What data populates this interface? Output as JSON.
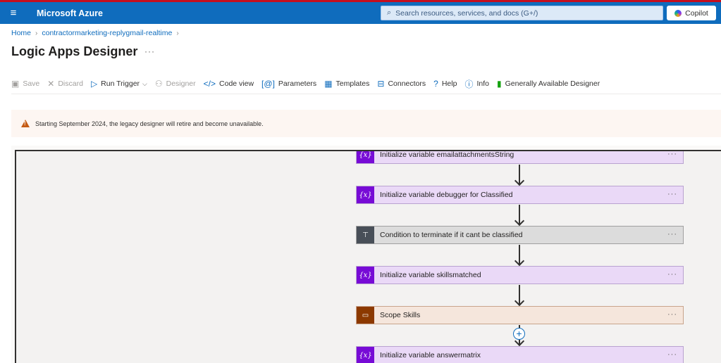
{
  "header": {
    "menu_icon": "hamburger-icon",
    "brand": "Microsoft Azure",
    "search_placeholder": "Search resources, services, and docs (G+/)",
    "copilot_label": "Copilot"
  },
  "breadcrumb": {
    "home": "Home",
    "resource": "contractormarketing-replygmail-realtime"
  },
  "page": {
    "title": "Logic Apps Designer",
    "more": "···"
  },
  "toolbar": {
    "save": "Save",
    "discard": "Discard",
    "run_trigger": "Run Trigger",
    "designer": "Designer",
    "code_view": "Code view",
    "parameters": "Parameters",
    "templates": "Templates",
    "connectors": "Connectors",
    "help": "Help",
    "info": "Info",
    "ga_designer": "Generally Available Designer"
  },
  "banner": {
    "text": "Starting September 2024, the legacy designer will retire and become unavailable."
  },
  "workflow": {
    "steps": [
      {
        "label": "Initialize variable emailattachmentsString",
        "kind": "variable",
        "badge": "{x}"
      },
      {
        "label": "Initialize variable debugger for Classified",
        "kind": "variable",
        "badge": "{x}"
      },
      {
        "label": "Condition to terminate if it cant be classified",
        "kind": "condition",
        "badge": "⊤"
      },
      {
        "label": "Initialize variable skillsmatched",
        "kind": "variable",
        "badge": "{x}"
      },
      {
        "label": "Scope Skills",
        "kind": "scope",
        "badge": "▭"
      },
      {
        "label": "Initialize variable answermatrix",
        "kind": "variable",
        "badge": "{x}"
      }
    ],
    "more": "···",
    "colors": {
      "variable": "#770bd6",
      "condition": "#484f58",
      "scope": "#8c3900"
    }
  }
}
